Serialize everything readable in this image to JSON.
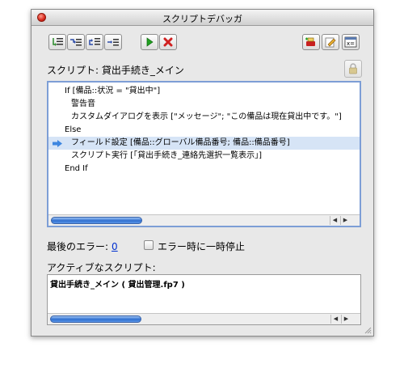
{
  "window": {
    "title": "スクリプトデバッガ"
  },
  "toolbar": {
    "buttons": [
      {
        "name": "step-into-icon"
      },
      {
        "name": "step-over-icon"
      },
      {
        "name": "step-out-icon"
      },
      {
        "name": "set-next-step-icon"
      },
      {
        "name": "run-icon",
        "color": "#20a020"
      },
      {
        "name": "halt-icon",
        "color": "#d02020"
      },
      {
        "name": "set-breakpoint-icon"
      },
      {
        "name": "edit-script-icon"
      },
      {
        "name": "data-viewer-icon"
      }
    ]
  },
  "script": {
    "label": "スクリプト: 貸出手続き_メイン",
    "lines": [
      {
        "text": "If [備品::状況 = \"貸出中\"]",
        "indent": 0,
        "current": false
      },
      {
        "text": "警告音",
        "indent": 1,
        "current": false
      },
      {
        "text": "カスタムダイアログを表示 [\"メッセージ\"; \"この備品は現在貸出中です。\"]",
        "indent": 1,
        "current": false
      },
      {
        "text": "Else",
        "indent": 0,
        "current": false
      },
      {
        "text": "フィールド設定 [備品::グローバル備品番号; 備品::備品番号]",
        "indent": 1,
        "current": true
      },
      {
        "text": "スクリプト実行 [「貸出手続き_連絡先選択一覧表示」]",
        "indent": 1,
        "current": false
      },
      {
        "text": "End If",
        "indent": 0,
        "current": false
      }
    ],
    "current_line_icon": "current-step-arrow-icon"
  },
  "last_error": {
    "label": "最後のエラー:",
    "value": "0"
  },
  "pause_on_error": {
    "label": "エラー時に一時停止",
    "checked": false
  },
  "active_scripts": {
    "label": "アクティブなスクリプト:",
    "items": [
      "貸出手続き_メイン ( 貸出管理.fp7 )"
    ]
  },
  "colors": {
    "selection": "#d6e4f6",
    "focus_border": "#7d9ed6",
    "arrow": "#3d86e0",
    "link": "#0030d0"
  }
}
